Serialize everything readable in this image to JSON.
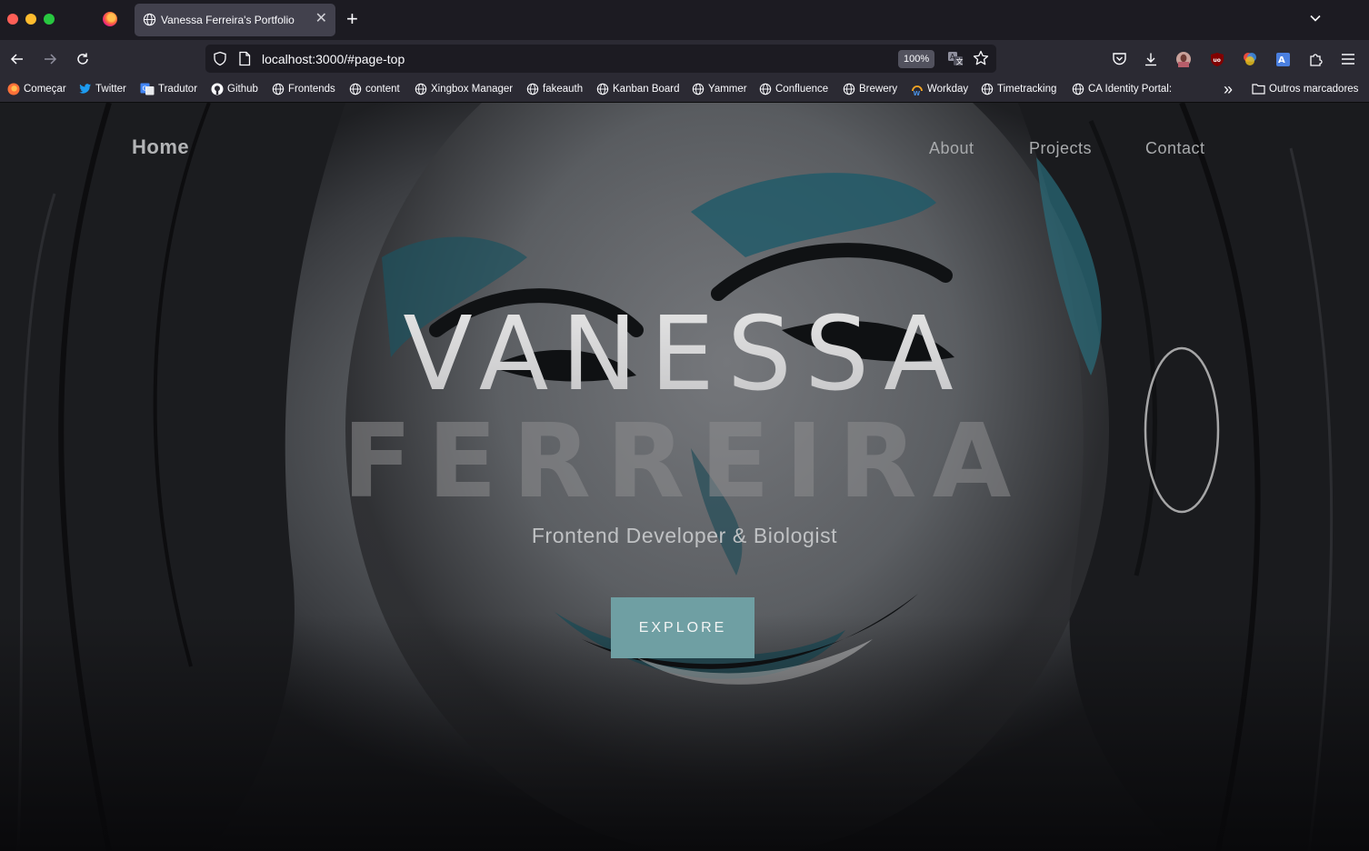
{
  "browser": {
    "tab_title": "Vanessa Ferreira's Portfolio",
    "tab_close": "✕",
    "new_tab": "+",
    "url": "localhost:3000/#page-top",
    "zoom": "100%"
  },
  "bookmarks": [
    {
      "label": "Começar",
      "icon": "firefox-icon"
    },
    {
      "label": "Twitter",
      "icon": "twitter-icon"
    },
    {
      "label": "Tradutor",
      "icon": "google-translate-icon"
    },
    {
      "label": "Github",
      "icon": "github-icon"
    },
    {
      "label": "Frontends",
      "icon": "globe-icon"
    },
    {
      "label": "content",
      "icon": "globe-icon"
    },
    {
      "label": "Xingbox Manager",
      "icon": "globe-icon"
    },
    {
      "label": "fakeauth",
      "icon": "globe-icon"
    },
    {
      "label": "Kanban Board",
      "icon": "globe-icon"
    },
    {
      "label": "Yammer",
      "icon": "globe-icon"
    },
    {
      "label": "Confluence",
      "icon": "globe-icon"
    },
    {
      "label": "Brewery",
      "icon": "globe-icon"
    },
    {
      "label": "Workday",
      "icon": "workday-icon"
    },
    {
      "label": "Timetracking",
      "icon": "globe-icon"
    },
    {
      "label": "CA Identity Portal:",
      "icon": "globe-icon"
    }
  ],
  "bookmarks_overflow": "»",
  "other_bookmarks": "Outros marcadores",
  "site": {
    "nav": {
      "home": "Home",
      "about": "About",
      "projects": "Projects",
      "contact": "Contact"
    },
    "hero": {
      "first_name": "VANESSA",
      "last_name": "FERREIRA",
      "subtitle": "Frontend Developer & Biologist",
      "cta": "EXPLORE"
    }
  },
  "colors": {
    "accent_button": "#6f9fa3",
    "tab_active": "#42414d",
    "toolbar": "#2b2a33"
  }
}
